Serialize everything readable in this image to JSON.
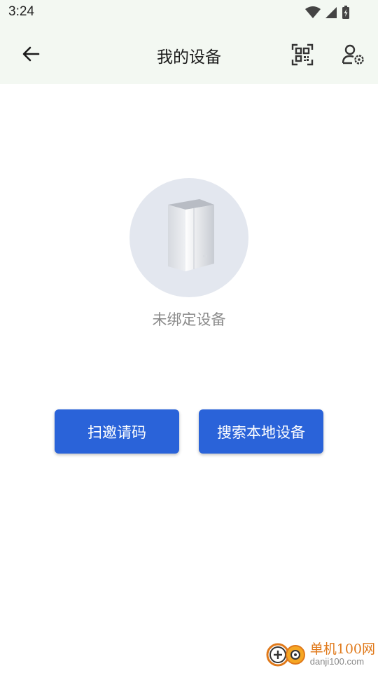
{
  "status_bar": {
    "time": "3:24"
  },
  "header": {
    "title": "我的设备"
  },
  "main": {
    "empty_message": "未绑定设备",
    "buttons": {
      "scan_invite": "扫邀请码",
      "search_local": "搜索本地设备"
    }
  },
  "watermark": {
    "name": "单机100网",
    "url": "danji100.com"
  },
  "icons": {
    "back": "back-arrow-icon",
    "qr": "qr-code-icon",
    "user_settings": "user-settings-icon",
    "device": "device-server-icon"
  },
  "colors": {
    "accent": "#2a63d9",
    "header_bg": "#f3f8f2",
    "circle_bg": "#e3e7ef",
    "muted_text": "#8a8a8a"
  }
}
